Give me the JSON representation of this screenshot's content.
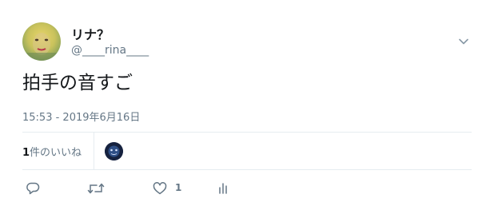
{
  "tweet": {
    "author": {
      "name": "リナ？",
      "handle": "@____rina____"
    },
    "text": "拍手の音すご",
    "timestamp": "15:53 - 2019年6月16日",
    "stats": {
      "likes_count": "1",
      "likes_label": "件のいいね"
    },
    "actions": {
      "like_count": "1"
    }
  },
  "icons": {
    "caret": "chevron-down-icon",
    "reply": "reply-icon",
    "retweet": "retweet-icon",
    "like": "heart-icon",
    "analytics": "analytics-icon"
  },
  "colors": {
    "text": "#14171a",
    "secondary": "#657786",
    "divider": "#e6ecf0"
  }
}
